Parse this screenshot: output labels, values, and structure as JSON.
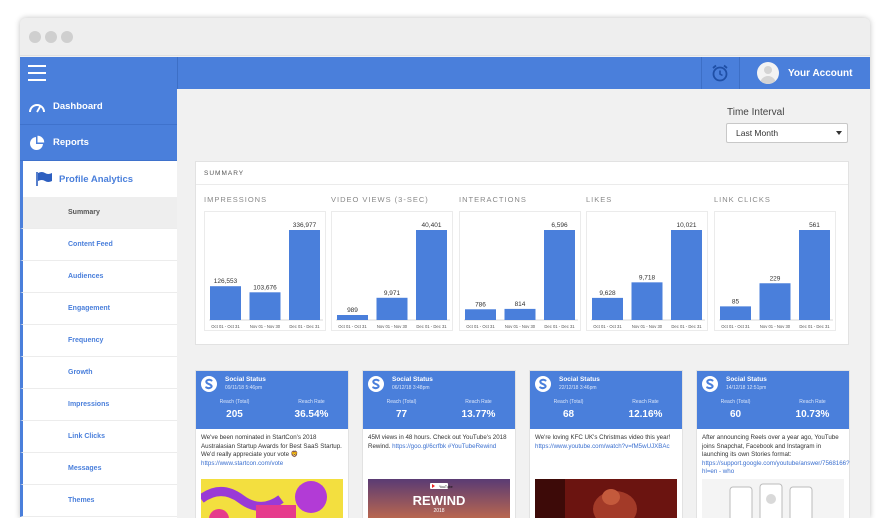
{
  "topbar": {
    "account_name": "Your Account"
  },
  "sidebar": {
    "main_items": [
      {
        "label": "Dashboard",
        "icon": "gauge-icon"
      },
      {
        "label": "Reports",
        "icon": "pie-chart-icon"
      }
    ],
    "active_item": {
      "label": "Profile Analytics",
      "icon": "flag-icon"
    },
    "sub_items": [
      {
        "label": "Summary"
      },
      {
        "label": "Content Feed"
      },
      {
        "label": "Audiences"
      },
      {
        "label": "Engagement"
      },
      {
        "label": "Frequency"
      },
      {
        "label": "Growth"
      },
      {
        "label": "Impressions"
      },
      {
        "label": "Link Clicks"
      },
      {
        "label": "Messages"
      },
      {
        "label": "Themes"
      }
    ]
  },
  "time_interval": {
    "label": "Time Interval",
    "selected": "Last Month"
  },
  "summary": {
    "title": "SUMMARY"
  },
  "chart_data": [
    {
      "type": "bar",
      "title": "IMPRESSIONS",
      "categories": [
        "Oct 01 - Oct 31",
        "Nov 01 - Nov 30",
        "Dec 01 - Dec 31"
      ],
      "values": [
        126553,
        103676,
        336977
      ],
      "labels": [
        "126,553",
        "103,676",
        "336,977"
      ],
      "ylim": [
        0,
        336977
      ]
    },
    {
      "type": "bar",
      "title": "VIDEO VIEWS (3-SEC)",
      "categories": [
        "Oct 01 - Oct 31",
        "Nov 01 - Nov 30",
        "Dec 01 - Dec 31"
      ],
      "values": [
        989,
        9971,
        40401
      ],
      "labels": [
        "989",
        "9,971",
        "40,401"
      ],
      "ylim": [
        0,
        40401
      ]
    },
    {
      "type": "bar",
      "title": "INTERACTIONS",
      "categories": [
        "Oct 01 - Oct 31",
        "Nov 01 - Nov 30",
        "Dec 01 - Dec 31"
      ],
      "values": [
        786,
        814,
        6596
      ],
      "labels": [
        "786",
        "814",
        "6,596"
      ],
      "ylim": [
        0,
        6596
      ]
    },
    {
      "type": "bar",
      "title": "LIKES",
      "categories": [
        "Oct 01 - Oct 31",
        "Nov 01 - Nov 30",
        "Dec 01 - Dec 31"
      ],
      "values": [
        9628,
        9718,
        10021
      ],
      "labels": [
        "9,628",
        "9,718",
        "10,021"
      ],
      "ylim": [
        9500,
        10021
      ]
    },
    {
      "type": "bar",
      "title": "LINK CLICKS",
      "categories": [
        "Oct 01 - Oct 31",
        "Nov 01 - Nov 30",
        "Dec 01 - Dec 31"
      ],
      "values": [
        85,
        229,
        561
      ],
      "labels": [
        "85",
        "229",
        "561"
      ],
      "ylim": [
        0,
        561
      ]
    }
  ],
  "cards": [
    {
      "name": "Social Status",
      "date": "09/11/18 5:46pm",
      "reach_label": "Reach (Total)",
      "reach": "205",
      "rate_label": "Reach Rate",
      "rate": "36.54%",
      "text": "We've been nominated in StartCon's 2018 Australasian Startup Awards for Best SaaS Startup. We'd really appreciate your vote 🦁",
      "link": "https://www.startcon.com/vote",
      "image": "colorful-shapes"
    },
    {
      "name": "Social Status",
      "date": "06/12/18 3:48pm",
      "reach_label": "Reach (Total)",
      "reach": "77",
      "rate_label": "Reach Rate",
      "rate": "13.77%",
      "text": "45M views in 48 hours. Check out YouTube's 2018 Rewind.",
      "link": "https://goo.gl/6crfbk #YouTubeRewind",
      "image_text": "REWIND",
      "image_badge": "YouTube",
      "image_year": "2018",
      "image": "rewind"
    },
    {
      "name": "Social Status",
      "date": "22/12/18 3:46pm",
      "reach_label": "Reach (Total)",
      "reach": "68",
      "rate_label": "Reach Rate",
      "rate": "12.16%",
      "text": "We're loving KFC UK's Christmas video this year!",
      "link": "https://www.youtube.com/watch?v=fM5wUJXBAc",
      "image": "red-scene"
    },
    {
      "name": "Social Status",
      "date": "14/12/18 12:51pm",
      "reach_label": "Reach (Total)",
      "reach": "60",
      "rate_label": "Reach Rate",
      "rate": "10.73%",
      "text": "After announcing Reels over a year ago, YouTube joins Snapchat, Facebook and Instagram in launching its own Stories format:",
      "link": "https://support.google.com/youtube/answer/7568166?hl=en - who",
      "image": "phones"
    }
  ]
}
